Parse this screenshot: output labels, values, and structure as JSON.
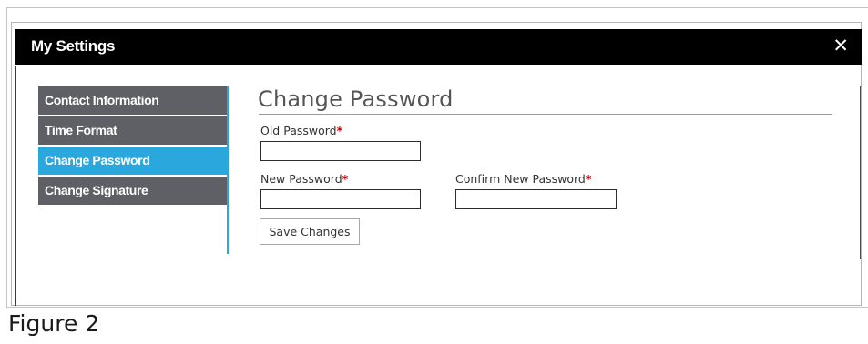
{
  "dialog": {
    "title": "My Settings",
    "close_symbol": "✕",
    "close_icon": "close-icon"
  },
  "sidebar": {
    "items": [
      {
        "label": "Contact Information",
        "active": false
      },
      {
        "label": "Time Format",
        "active": false
      },
      {
        "label": "Change Password",
        "active": true
      },
      {
        "label": "Change Signature",
        "active": false
      }
    ]
  },
  "form": {
    "title": "Change Password",
    "old_password": {
      "label": "Old Password",
      "required_mark": "*",
      "value": ""
    },
    "new_password": {
      "label": "New Password",
      "required_mark": "*",
      "value": ""
    },
    "confirm_password": {
      "label": "Confirm New Password",
      "required_mark": "*",
      "value": ""
    },
    "save_label": "Save Changes"
  },
  "caption": "Figure 2",
  "colors": {
    "header_bg": "#000000",
    "sidebar_item_bg": "#5e6066",
    "sidebar_active_bg": "#2aa7dc",
    "required_mark": "#cc0000"
  }
}
